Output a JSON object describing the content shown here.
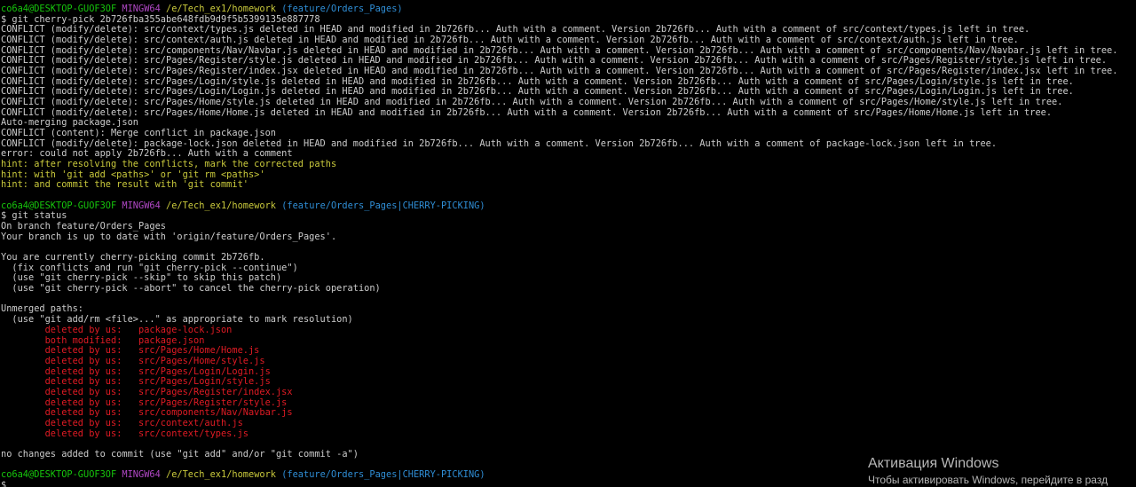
{
  "colors": {
    "background": "#000000",
    "text": "#cccccc",
    "prompt_user": "#16c60c",
    "prompt_env": "#b148c6",
    "prompt_path": "#c9c93c",
    "prompt_branch": "#2f8ed6",
    "conflict_files": "#e01b24",
    "hint": "#c9c93c"
  },
  "prompts": [
    {
      "user": "co6a4@DESKTOP-GUOF3OF",
      "env": "MINGW64",
      "path": "/e/Tech_ex1/homework",
      "branch": "(feature/Orders_Pages)"
    },
    {
      "user": "co6a4@DESKTOP-GUOF3OF",
      "env": "MINGW64",
      "path": "/e/Tech_ex1/homework",
      "branch": "(feature/Orders_Pages|CHERRY-PICKING)"
    },
    {
      "user": "co6a4@DESKTOP-GUOF3OF",
      "env": "MINGW64",
      "path": "/e/Tech_ex1/homework",
      "branch": "(feature/Orders_Pages|CHERRY-PICKING)"
    }
  ],
  "commands": [
    "$ git cherry-pick 2b726fba355abe648fdb9d9f5b5399135e887778",
    "$ git status",
    "$ "
  ],
  "cherry_pick_output": [
    "CONFLICT (modify/delete): src/context/types.js deleted in HEAD and modified in 2b726fb... Auth with a comment. Version 2b726fb... Auth with a comment of src/context/types.js left in tree.",
    "CONFLICT (modify/delete): src/context/auth.js deleted in HEAD and modified in 2b726fb... Auth with a comment. Version 2b726fb... Auth with a comment of src/context/auth.js left in tree.",
    "CONFLICT (modify/delete): src/components/Nav/Navbar.js deleted in HEAD and modified in 2b726fb... Auth with a comment. Version 2b726fb... Auth with a comment of src/components/Nav/Navbar.js left in tree.",
    "CONFLICT (modify/delete): src/Pages/Register/style.js deleted in HEAD and modified in 2b726fb... Auth with a comment. Version 2b726fb... Auth with a comment of src/Pages/Register/style.js left in tree.",
    "CONFLICT (modify/delete): src/Pages/Register/index.jsx deleted in HEAD and modified in 2b726fb... Auth with a comment. Version 2b726fb... Auth with a comment of src/Pages/Register/index.jsx left in tree.",
    "CONFLICT (modify/delete): src/Pages/Login/style.js deleted in HEAD and modified in 2b726fb... Auth with a comment. Version 2b726fb... Auth with a comment of src/Pages/Login/style.js left in tree.",
    "CONFLICT (modify/delete): src/Pages/Login/Login.js deleted in HEAD and modified in 2b726fb... Auth with a comment. Version 2b726fb... Auth with a comment of src/Pages/Login/Login.js left in tree.",
    "CONFLICT (modify/delete): src/Pages/Home/style.js deleted in HEAD and modified in 2b726fb... Auth with a comment. Version 2b726fb... Auth with a comment of src/Pages/Home/style.js left in tree.",
    "CONFLICT (modify/delete): src/Pages/Home/Home.js deleted in HEAD and modified in 2b726fb... Auth with a comment. Version 2b726fb... Auth with a comment of src/Pages/Home/Home.js left in tree.",
    "Auto-merging package.json",
    "CONFLICT (content): Merge conflict in package.json",
    "CONFLICT (modify/delete): package-lock.json deleted in HEAD and modified in 2b726fb... Auth with a comment. Version 2b726fb... Auth with a comment of package-lock.json left in tree.",
    "error: could not apply 2b726fb... Auth with a comment"
  ],
  "hints": [
    "hint: after resolving the conflicts, mark the corrected paths",
    "hint: with 'git add <paths>' or 'git rm <paths>'",
    "hint: and commit the result with 'git commit'"
  ],
  "status_output": [
    "On branch feature/Orders_Pages",
    "Your branch is up to date with 'origin/feature/Orders_Pages'.",
    "",
    "You are currently cherry-picking commit 2b726fb.",
    "  (fix conflicts and run \"git cherry-pick --continue\")",
    "  (use \"git cherry-pick --skip\" to skip this patch)",
    "  (use \"git cherry-pick --abort\" to cancel the cherry-pick operation)",
    "",
    "Unmerged paths:",
    "  (use \"git add/rm <file>...\" as appropriate to mark resolution)"
  ],
  "unmerged_paths": [
    "\tdeleted by us:   package-lock.json",
    "\tboth modified:   package.json",
    "\tdeleted by us:   src/Pages/Home/Home.js",
    "\tdeleted by us:   src/Pages/Home/style.js",
    "\tdeleted by us:   src/Pages/Login/Login.js",
    "\tdeleted by us:   src/Pages/Login/style.js",
    "\tdeleted by us:   src/Pages/Register/index.jsx",
    "\tdeleted by us:   src/Pages/Register/style.js",
    "\tdeleted by us:   src/components/Nav/Navbar.js",
    "\tdeleted by us:   src/context/auth.js",
    "\tdeleted by us:   src/context/types.js"
  ],
  "status_footer": "no changes added to commit (use \"git add\" and/or \"git commit -a\")",
  "activation": {
    "title": "Активация Windows",
    "subtitle": "Чтобы активировать Windows, перейдите в разд"
  }
}
